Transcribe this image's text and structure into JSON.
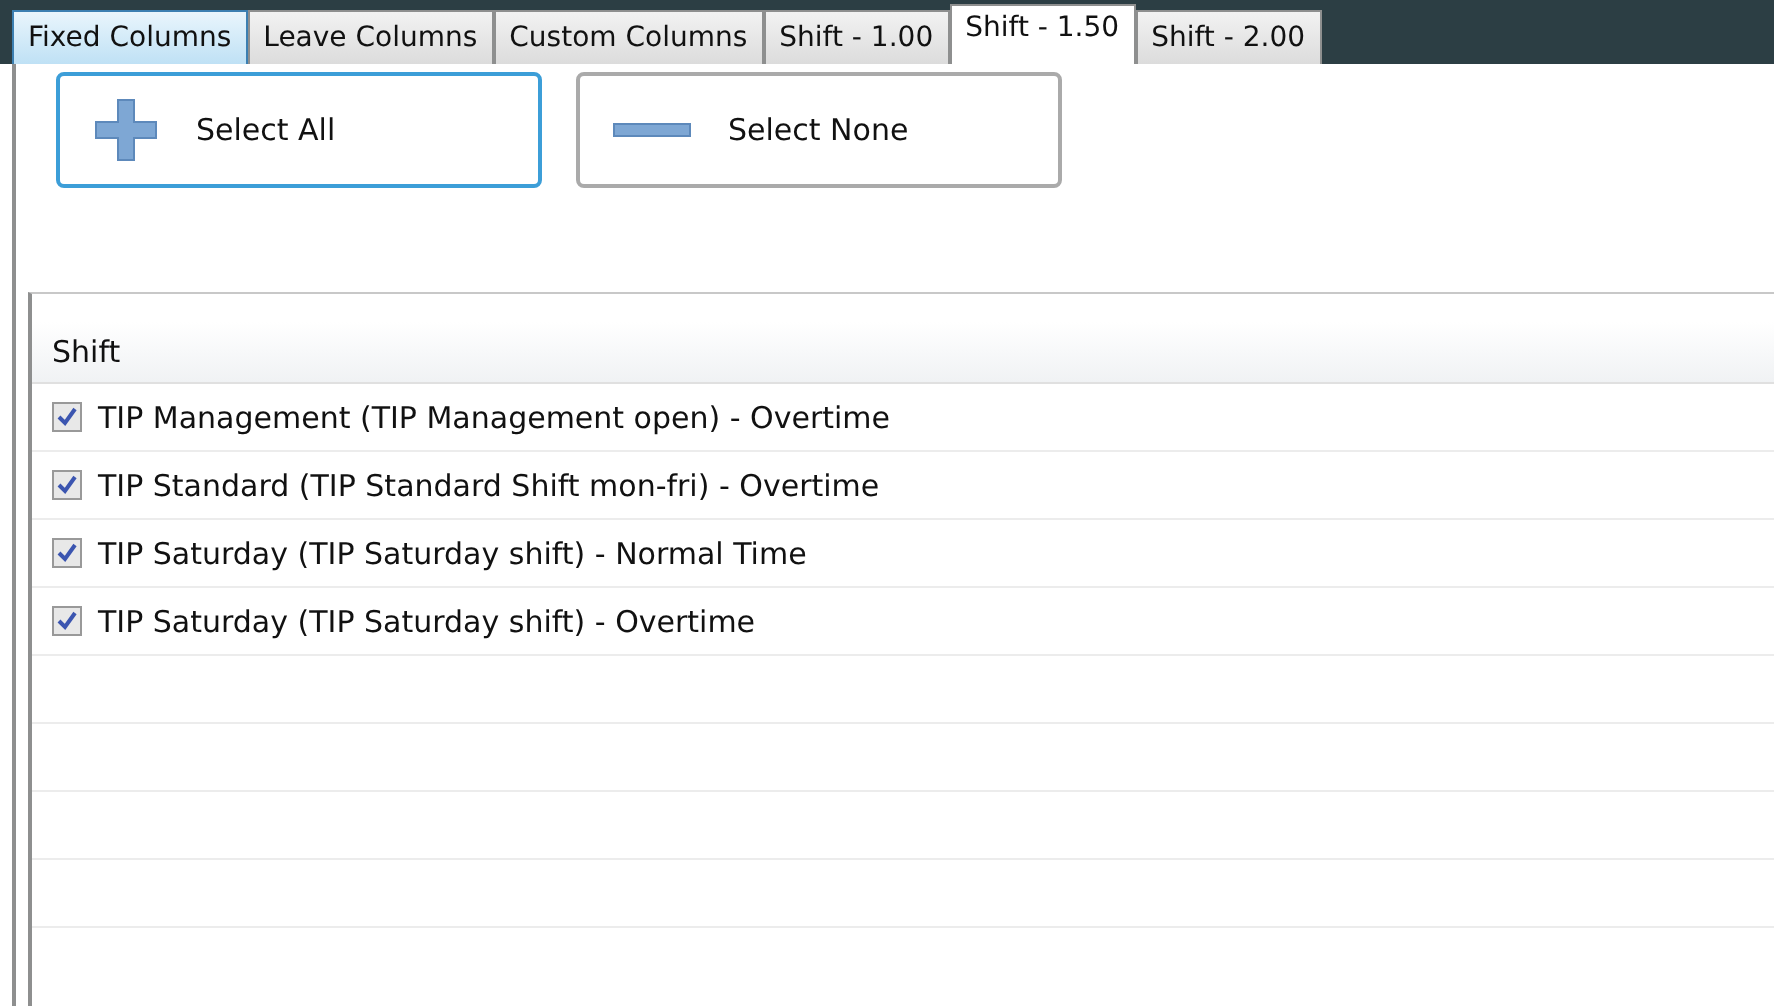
{
  "tabs": [
    {
      "label": "Fixed Columns",
      "selected": false,
      "hovered": true
    },
    {
      "label": "Leave Columns",
      "selected": false,
      "hovered": false
    },
    {
      "label": "Custom Columns",
      "selected": false,
      "hovered": false
    },
    {
      "label": "Shift - 1.00",
      "selected": false,
      "hovered": false
    },
    {
      "label": "Shift - 1.50",
      "selected": true,
      "hovered": false
    },
    {
      "label": "Shift - 2.00",
      "selected": false,
      "hovered": false
    }
  ],
  "buttons": [
    {
      "kind": "plus",
      "label": "Select All",
      "focused": true
    },
    {
      "kind": "minus",
      "label": "Select None",
      "focused": false
    }
  ],
  "list": {
    "column": "Shift",
    "rows": [
      {
        "label": "TIP Management (TIP Management open) - Overtime",
        "checked": true
      },
      {
        "label": "TIP Standard (TIP Standard Shift mon-fri) - Overtime",
        "checked": true
      },
      {
        "label": "TIP Saturday (TIP Saturday shift) - Normal Time",
        "checked": true
      },
      {
        "label": "TIP Saturday (TIP Saturday shift) - Overtime",
        "checked": true
      }
    ]
  }
}
